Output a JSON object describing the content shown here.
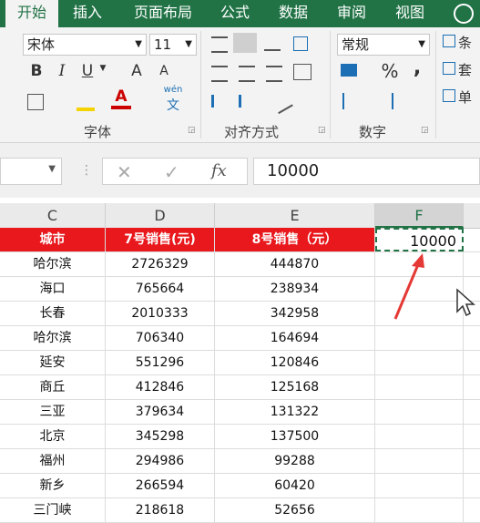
{
  "tabs": [
    "开始",
    "插入",
    "页面布局",
    "公式",
    "数据",
    "审阅",
    "视图"
  ],
  "font": {
    "name": "宋体",
    "size": "11"
  },
  "format": {
    "number_format": "常规"
  },
  "groups": {
    "font": "字体",
    "align": "对齐方式",
    "number": "数字"
  },
  "ribbon_buttons": {
    "bold": "B",
    "italic": "I",
    "underline": "U",
    "grow": "A",
    "shrink": "A",
    "font_color": "A",
    "phonetic_top": "wén",
    "phonetic_bottom": "文",
    "percent": "%",
    "comma": ",",
    "conditional": "条",
    "table_fmt": "套",
    "cell_style": "单"
  },
  "formula_bar": {
    "cancel": "✕",
    "enter": "✓",
    "fx": "fx",
    "value": "10000"
  },
  "columns": [
    "C",
    "D",
    "E",
    "F"
  ],
  "table": {
    "headers": [
      "城市",
      "7号销售(元)",
      "8号销售（元）"
    ],
    "rows": [
      [
        "哈尔滨",
        "2726329",
        "444870"
      ],
      [
        "海口",
        "765664",
        "238934"
      ],
      [
        "长春",
        "2010333",
        "342958"
      ],
      [
        "哈尔滨",
        "706340",
        "164694"
      ],
      [
        "延安",
        "551296",
        "120846"
      ],
      [
        "商丘",
        "412846",
        "125168"
      ],
      [
        "三亚",
        "379634",
        "131322"
      ],
      [
        "北京",
        "345298",
        "137500"
      ],
      [
        "福州",
        "294986",
        "99288"
      ],
      [
        "新乡",
        "266594",
        "60420"
      ],
      [
        "三门峡",
        "218618",
        "52656"
      ]
    ]
  },
  "active_cell_value": "10000",
  "colors": {
    "ribbon_green": "#217346",
    "header_red": "#e8181d",
    "arrow": "#e53935"
  }
}
